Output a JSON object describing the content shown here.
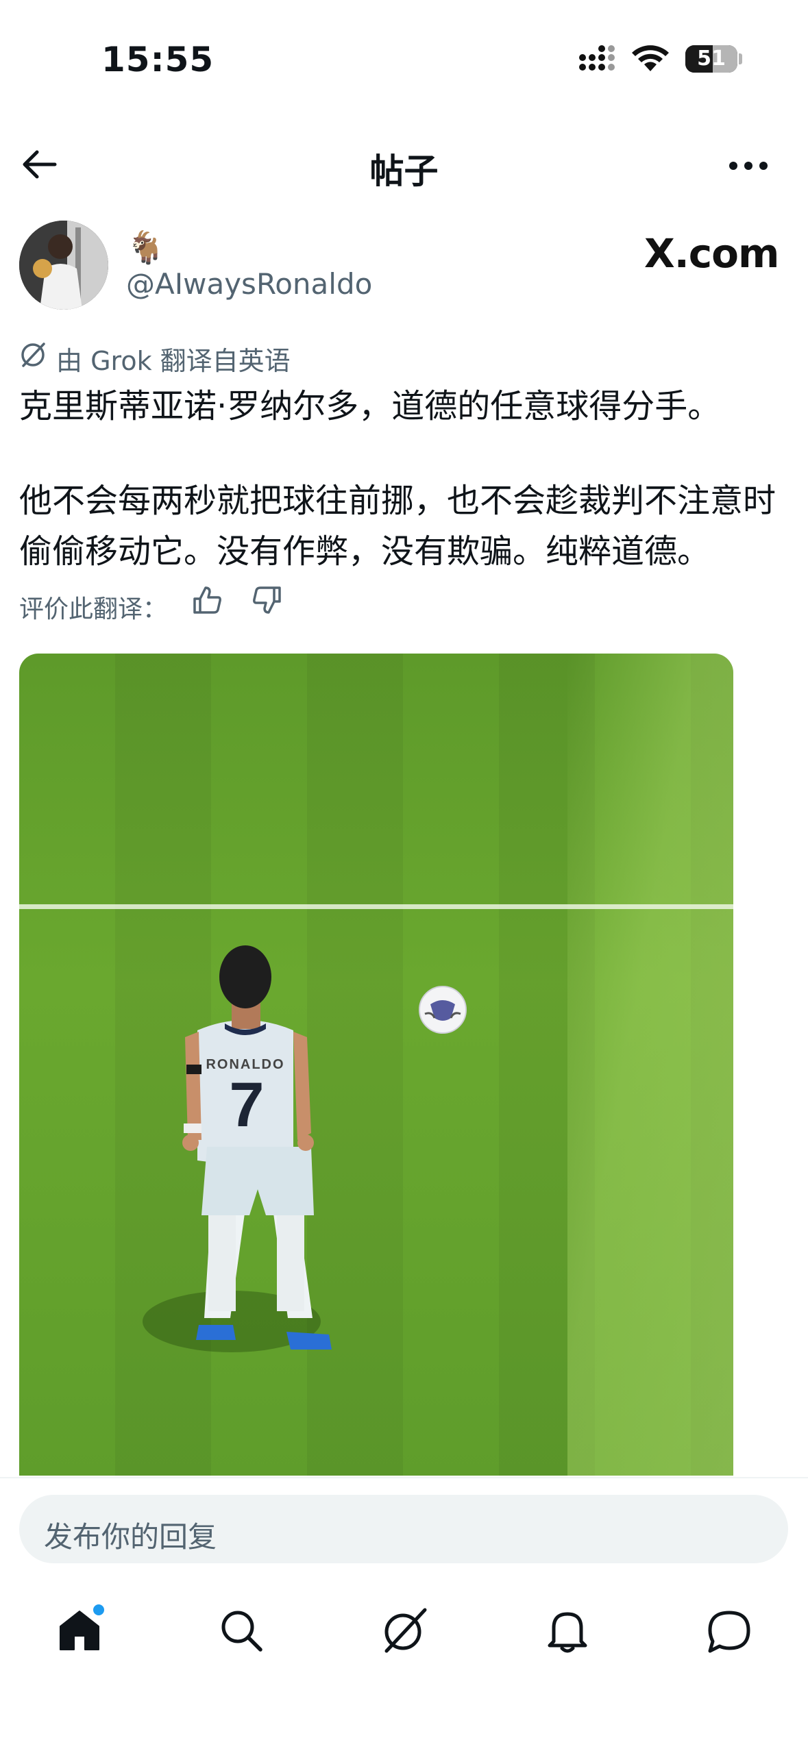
{
  "status_bar": {
    "time": "15:55",
    "battery": "51"
  },
  "header": {
    "title": "帖子"
  },
  "author": {
    "name_emoji": "🐐",
    "handle": "@AIwaysRonaldo",
    "watermark": "X.com"
  },
  "post": {
    "translation_note": "由 Grok 翻译自英语",
    "paragraphs": [
      "克里斯蒂亚诺·罗纳尔多，道德的任意球得分手。",
      "他不会每两秒就把球往前挪，也不会趁裁判不注意时偷偷移动它。没有作弊，没有欺骗。纯粹道德。"
    ],
    "rate_label": "评价此翻译："
  },
  "media": {
    "jersey_number": "7",
    "jersey_name": "RONALDO"
  },
  "reply": {
    "placeholder": "发布你的回复"
  },
  "colors": {
    "accent": "#1d9bf0",
    "secondary_text": "#536471",
    "pitch": "#63a32d"
  },
  "tabs": [
    {
      "icon": "home-icon"
    },
    {
      "icon": "search-icon"
    },
    {
      "icon": "grok-icon"
    },
    {
      "icon": "bell-icon"
    },
    {
      "icon": "chat-icon"
    }
  ]
}
